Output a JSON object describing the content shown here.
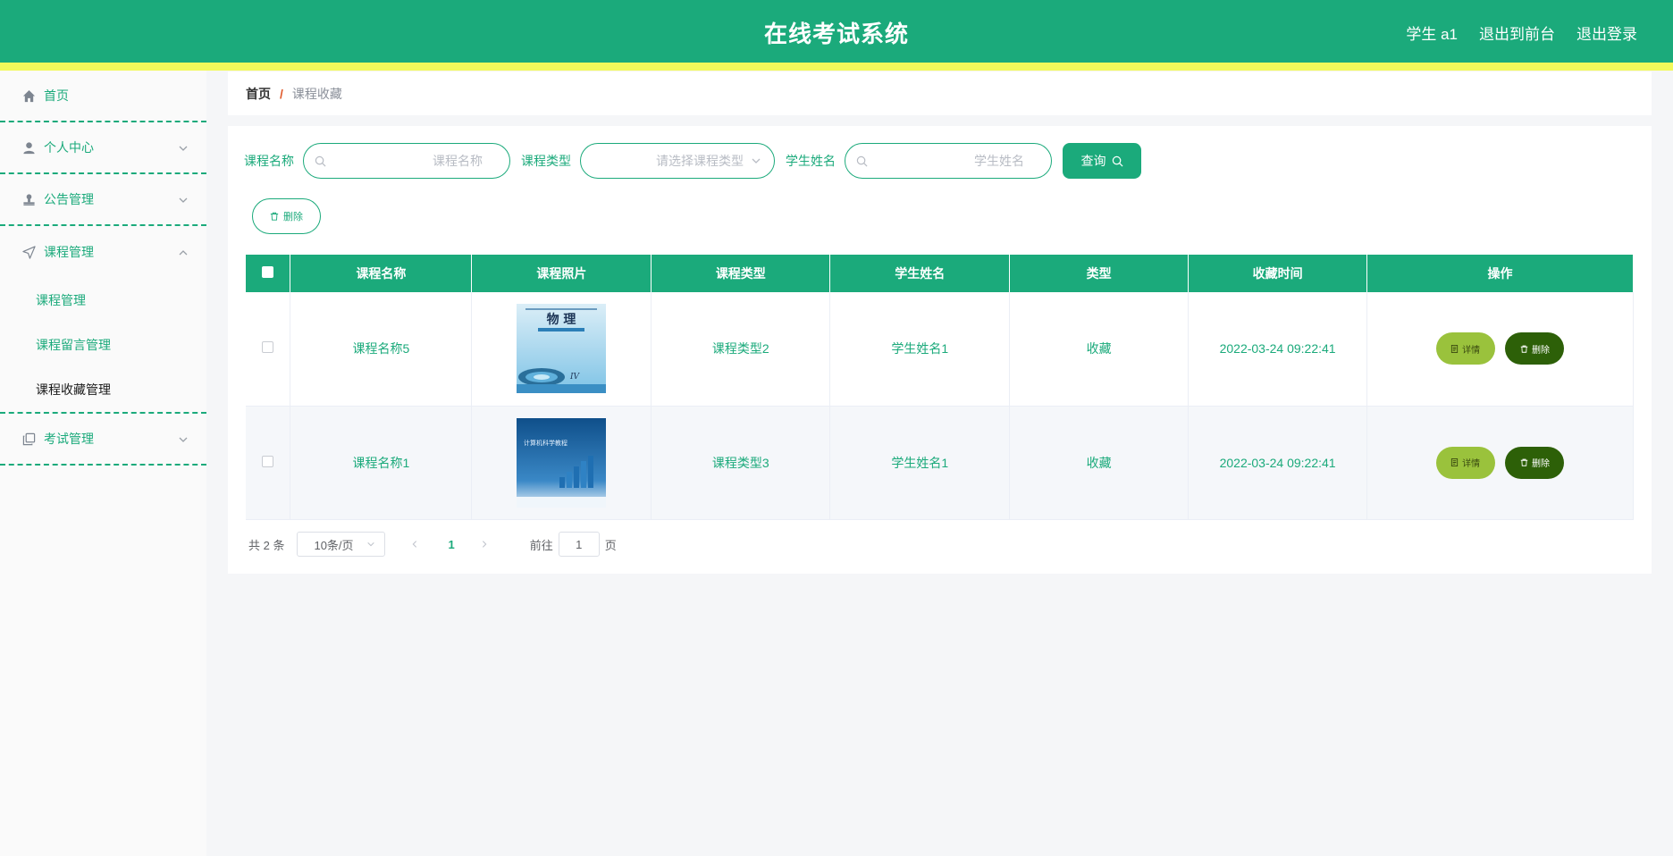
{
  "header": {
    "title": "在线考试系统",
    "user": "学生 a1",
    "to_front": "退出到前台",
    "logout": "退出登录",
    "bg_color": "#1baa7b",
    "stripe_color": "#f2f95a"
  },
  "sidebar": {
    "items": [
      {
        "label": "首页",
        "icon": "home-icon"
      },
      {
        "label": "个人中心",
        "icon": "user-icon"
      },
      {
        "label": "公告管理",
        "icon": "stamp-icon"
      },
      {
        "label": "课程管理",
        "icon": "send-icon",
        "children": [
          "课程管理",
          "课程留言管理",
          "课程收藏管理"
        ]
      },
      {
        "label": "考试管理",
        "icon": "copy-icon"
      }
    ]
  },
  "breadcrumb": {
    "home": "首页",
    "sep": "/",
    "current": "课程收藏"
  },
  "search": {
    "course_name_label": "课程名称",
    "course_name_placeholder": "课程名称",
    "course_type_label": "课程类型",
    "course_type_placeholder": "请选择课程类型",
    "student_label": "学生姓名",
    "student_placeholder": "学生姓名",
    "query_label": "查询"
  },
  "actions": {
    "delete_label": "删除"
  },
  "table": {
    "columns": [
      "课程名称",
      "课程照片",
      "课程类型",
      "学生姓名",
      "类型",
      "收藏时间",
      "操作"
    ],
    "rows": [
      {
        "name": "课程名称5",
        "type": "课程类型2",
        "student": "学生姓名1",
        "kind": "收藏",
        "time": "2022-03-24 09:22:41",
        "photo": "physics-book-cover"
      },
      {
        "name": "课程名称1",
        "type": "课程类型3",
        "student": "学生姓名1",
        "kind": "收藏",
        "time": "2022-03-24 09:22:41",
        "photo": "computer-book-cover"
      }
    ],
    "detail_label": "详情",
    "delete_label": "删除",
    "cover1_title": "物 理",
    "cover2_title": "计算机科学教程"
  },
  "pager": {
    "total": "共 2 条",
    "page_size": "10条/页",
    "current": "1",
    "goto": "前往",
    "goto_value": "1",
    "page_unit": "页"
  }
}
